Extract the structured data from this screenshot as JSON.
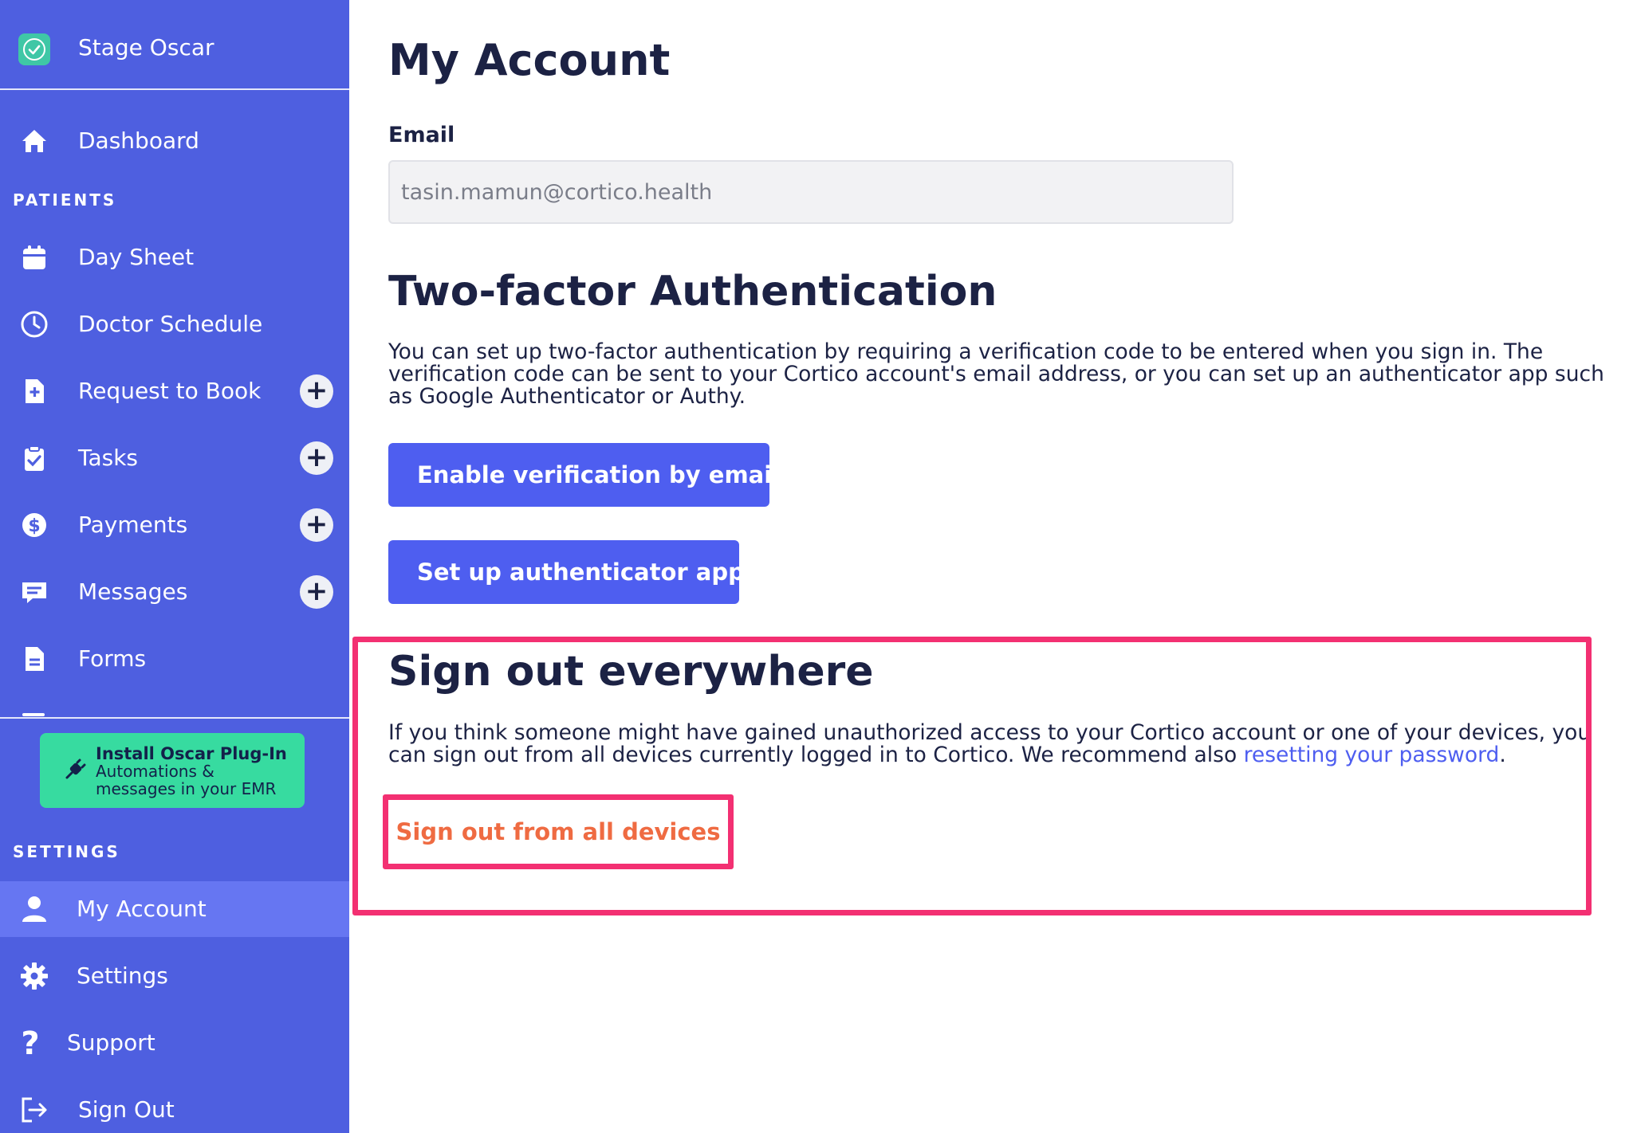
{
  "sidebar": {
    "brand": "Stage Oscar",
    "dashboard": "Dashboard",
    "section_patients": "PATIENTS",
    "items": [
      {
        "label": "Day Sheet",
        "icon": "calendar-icon"
      },
      {
        "label": "Doctor Schedule",
        "icon": "clock-icon"
      },
      {
        "label": "Request to Book",
        "icon": "file-plus-icon",
        "plus": "+"
      },
      {
        "label": "Tasks",
        "icon": "clipboard-check-icon",
        "plus": "+"
      },
      {
        "label": "Payments",
        "icon": "dollar-circle-icon",
        "plus": "+"
      },
      {
        "label": "Messages",
        "icon": "message-icon",
        "plus": "+"
      },
      {
        "label": "Forms",
        "icon": "document-icon"
      }
    ],
    "plugin": {
      "title": "Install Oscar Plug-In",
      "line1": "Automations &",
      "line2": "messages in your EMR"
    },
    "section_settings": "SETTINGS",
    "settings_items": [
      {
        "label": "My Account",
        "icon": "user-icon",
        "active": true
      },
      {
        "label": "Settings",
        "icon": "gear-icon"
      },
      {
        "label": "Support",
        "icon": "question-icon"
      },
      {
        "label": "Sign Out",
        "icon": "sign-out-icon"
      }
    ]
  },
  "main": {
    "title": "My Account",
    "email_label": "Email",
    "email_value": "tasin.mamun@cortico.health",
    "twofa": {
      "heading": "Two-factor Authentication",
      "description": "You can set up two-factor authentication by requiring a verification code to be entered when you sign in. The verification code can be sent to your Cortico account's email address, or you can set up an authenticator app such as Google Authenticator or Authy.",
      "btn_email": "Enable verification by email",
      "btn_app": "Set up authenticator app"
    },
    "signout": {
      "heading": "Sign out everywhere",
      "description": "If you think someone might have gained unauthorized access to your Cortico account or one of your devices, you can sign out from all devices currently logged in to Cortico. We recommend also",
      "link_text": "resetting your password",
      "after_link": ".",
      "button": "Sign out from all devices"
    }
  },
  "colors": {
    "sidebar": "#4e5fe0",
    "primary": "#4e5ef0",
    "highlight": "#f33072",
    "danger_text": "#ef6b42",
    "plugin_bg": "#37dba0"
  }
}
